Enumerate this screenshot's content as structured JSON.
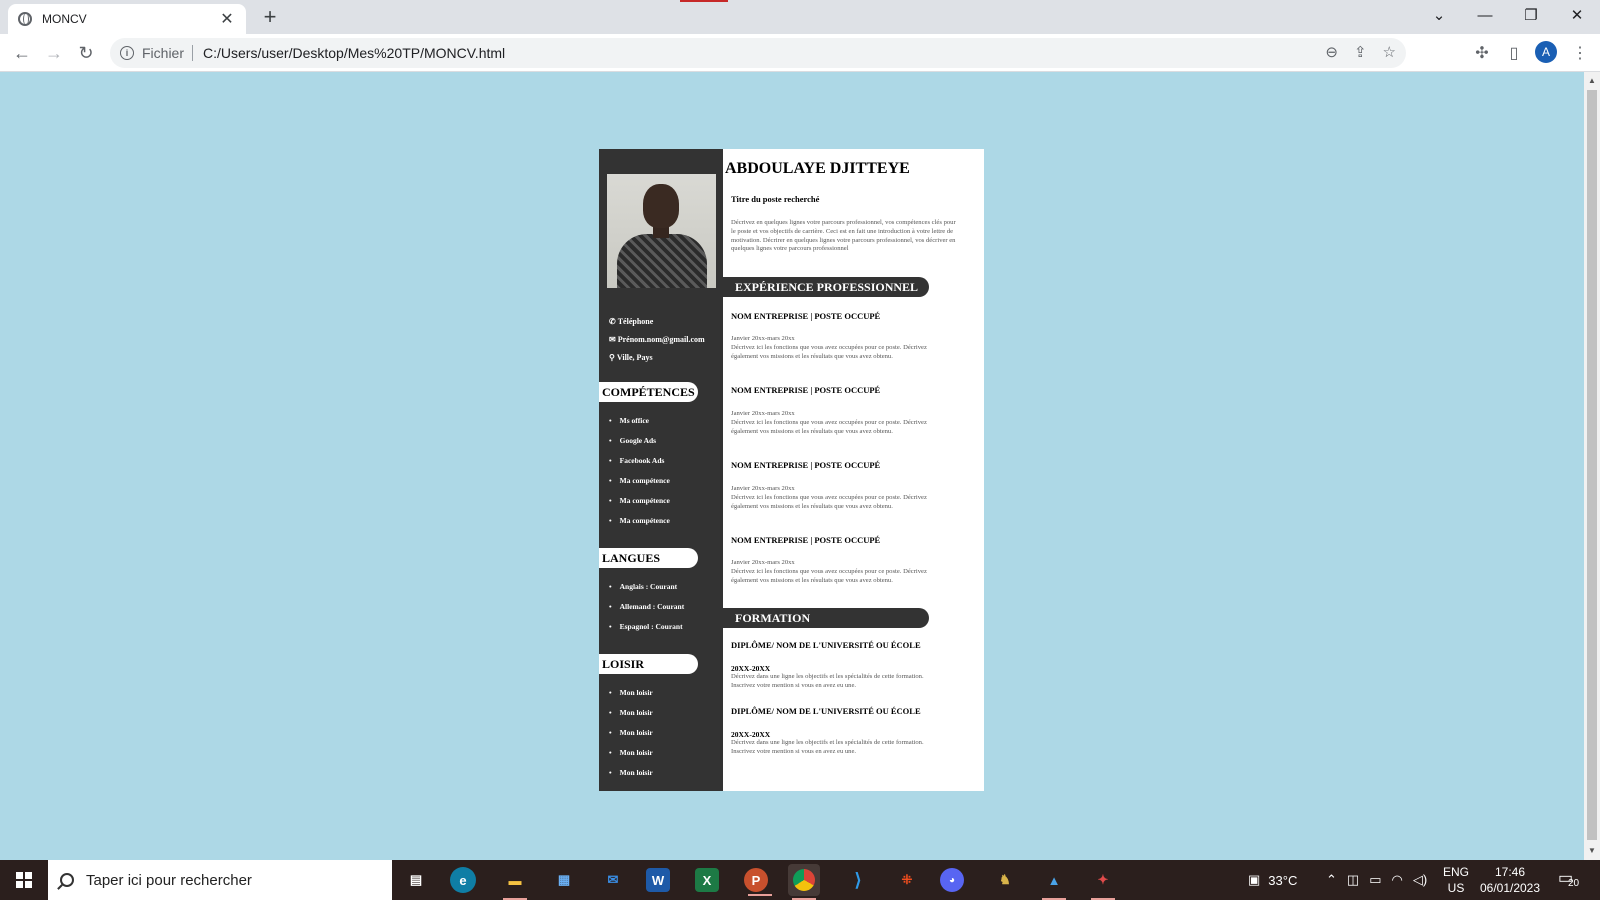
{
  "browser": {
    "tab_title": "MONCV",
    "new_tab": "+",
    "address_scheme": "Fichier",
    "address_url": "C:/Users/user/Desktop/Mes%20TP/MONCV.html",
    "profile_initial": "A"
  },
  "cv": {
    "name": "ABDOULAYE DJITTEYE",
    "job_title": "Titre du poste recherché",
    "intro": "Décrivez en quelques lignes votre parcours professionnel, vos compétences clés pour le poste et vos objectifs de carrière. Ceci est en fait une introduction à votre lettre de motivation. Décrirer en quelques lignes votre parcours professionnel, vos décriver en quelques lignes votre parcours professionnel",
    "contact": {
      "phone": "Téléphone",
      "email": "Prénom.nom@gmail.com",
      "location": "Ville, Pays"
    },
    "skills_heading": "COMPÉTENCES",
    "skills": [
      "Ms office",
      "Google Ads",
      "Facebook Ads",
      "Ma compétence",
      "Ma compétence",
      "Ma compétence"
    ],
    "languages_heading": "LANGUES",
    "languages": [
      "Anglais : Courant",
      "Allemand : Courant",
      "Espagnol : Courant"
    ],
    "hobbies_heading": "LOISIR",
    "hobbies": [
      "Mon loisir",
      "Mon loisir",
      "Mon loisir",
      "Mon loisir",
      "Mon loisir"
    ],
    "experience_heading": "EXPÉRIENCE PROFESSIONNEL",
    "experiences": [
      {
        "title": "NOM ENTREPRISE | POSTE OCCUPÉ",
        "dates": "Janvier 20xx-mars 20xx",
        "desc": "Décrivez ici les fonctions que vous avez occupées pour ce poste. Décrivez également vos missions et les résultats que vous avez obtenu."
      },
      {
        "title": "NOM ENTREPRISE | POSTE OCCUPÉ",
        "dates": "Janvier 20xx-mars 20xx",
        "desc": "Décrivez ici les fonctions que vous avez occupées pour ce poste. Décrivez également vos missions et les résultats que vous avez obtenu."
      },
      {
        "title": "NOM ENTREPRISE | POSTE OCCUPÉ",
        "dates": "Janvier 20xx-mars 20xx",
        "desc": "Décrivez ici les fonctions que vous avez occupées pour ce poste. Décrivez également vos missions et les résultats que vous avez obtenu."
      },
      {
        "title": "NOM ENTREPRISE | POSTE OCCUPÉ",
        "dates": "Janvier 20xx-mars 20xx",
        "desc": "Décrivez ici les fonctions que vous avez occupées pour ce poste. Décrivez également vos missions et les résultats que vous avez obtenu."
      }
    ],
    "education_heading": "FORMATION",
    "education": [
      {
        "title": "DIPLÔME/ NOM DE L'UNIVERSITÉ OU ÉCOLE",
        "years": "20XX-20XX",
        "desc": "Décrivez dans une ligne les objectifs et les spécialités de cette formation. Inscrivez votre mention si vous en avez eu une."
      },
      {
        "title": "DIPLÔME/ NOM DE L'UNIVERSITÉ OU ÉCOLE",
        "years": "20XX-20XX",
        "desc": "Décrivez dans une ligne les objectifs et les spécialités de cette formation. Inscrivez votre mention si vous en avez eu une."
      }
    ]
  },
  "taskbar": {
    "search_placeholder": "Taper ici pour rechercher",
    "temperature": "33°C",
    "lang_line1": "ENG",
    "lang_line2": "US",
    "time": "17:46",
    "date": "06/01/2023",
    "notification_count": "20",
    "apps": [
      "task-view",
      "edge",
      "file-explorer",
      "store",
      "mail",
      "word",
      "excel",
      "powerpoint",
      "chrome",
      "vscode",
      "figma",
      "discord",
      "app-game",
      "photos",
      "app-red"
    ]
  },
  "colors": {
    "page_background": "#add8e6",
    "sidebar": "#333333",
    "taskbar": "#2b1f1d"
  }
}
